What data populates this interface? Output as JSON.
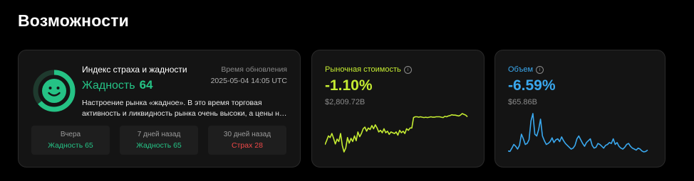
{
  "section": {
    "title": "Возможности"
  },
  "fear_greed": {
    "title": "Индекс страха и жадности",
    "updated_label": "Время обновления",
    "updated_time": "2025-05-04 14:05 UTC",
    "state_label": "Жадность",
    "index_value": "64",
    "gauge_fraction": 0.64,
    "description": "Настроение рынка «жадное». В это время торговая активность и ликвидность рынка очень высоки, а цены на валюту сильно коле...",
    "history": [
      {
        "label": "Вчера",
        "value": "Жадность 65",
        "tone": "green"
      },
      {
        "label": "7 дней назад",
        "value": "Жадность 65",
        "tone": "green"
      },
      {
        "label": "30 дней назад",
        "value": "Страх 28",
        "tone": "red"
      }
    ],
    "colors": {
      "greed": "#25c285",
      "fear": "#f04848"
    }
  },
  "market_cap": {
    "title": "Рыночная стоимость",
    "info_icon": "info-icon",
    "change": "-1.10%",
    "value": "$2,809.72B",
    "color": "#c5ec32",
    "spark": [
      30,
      40,
      52,
      48,
      58,
      46,
      32,
      44,
      38,
      58,
      28,
      12,
      22,
      48,
      34,
      46,
      38,
      52,
      40,
      62,
      50,
      58,
      70,
      74,
      64,
      72,
      68,
      78,
      70,
      80,
      72,
      62,
      66,
      60,
      70,
      60,
      64,
      56,
      62,
      60,
      58,
      62,
      54,
      66,
      60,
      64,
      58,
      70,
      66,
      72,
      72,
      98,
      100,
      100,
      99,
      100,
      99,
      98,
      99,
      98,
      99,
      100,
      99,
      99,
      100,
      100,
      100,
      99,
      98,
      101,
      100,
      102,
      103,
      105,
      104,
      104,
      103,
      102,
      104,
      108,
      106,
      104,
      100
    ]
  },
  "volume": {
    "title": "Объем",
    "info_icon": "info-icon",
    "change": "-6.59%",
    "value": "$65.86B",
    "color": "#3aa8ee",
    "spark": [
      4,
      3,
      10,
      18,
      14,
      8,
      16,
      40,
      30,
      18,
      20,
      28,
      68,
      84,
      40,
      36,
      50,
      72,
      36,
      26,
      18,
      20,
      24,
      32,
      22,
      28,
      30,
      24,
      34,
      26,
      20,
      16,
      12,
      8,
      10,
      16,
      30,
      36,
      28,
      20,
      14,
      22,
      26,
      30,
      16,
      10,
      12,
      20,
      18,
      14,
      10,
      16,
      18,
      22,
      20,
      30,
      18,
      22,
      14,
      10,
      8,
      12,
      18,
      20,
      14,
      10,
      8,
      6,
      10,
      8,
      4,
      2,
      3,
      6
    ]
  }
}
